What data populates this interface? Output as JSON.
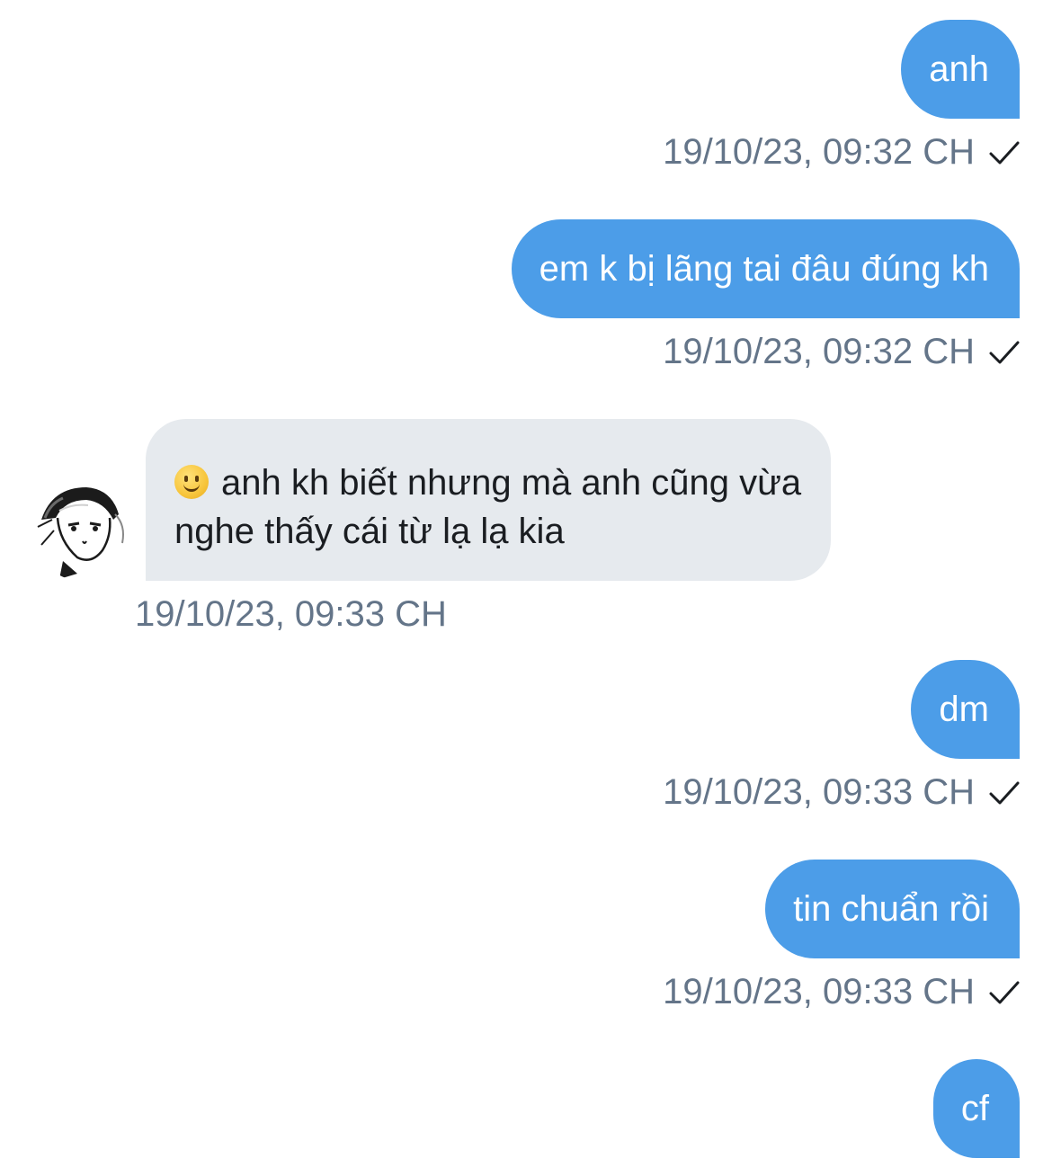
{
  "thread": {
    "messages": [
      {
        "direction": "outgoing",
        "text": "anh",
        "timestamp": "19/10/23, 09:32 CH",
        "status_icon": "check-icon"
      },
      {
        "direction": "outgoing",
        "text": "em k bị lãng tai đâu đúng kh",
        "timestamp": "19/10/23, 09:32 CH",
        "status_icon": "check-icon"
      },
      {
        "direction": "incoming",
        "emoji": "slightly-smiling-face",
        "text": "anh kh biết nhưng mà anh cũng vừa nghe thấy cái từ lạ lạ kia",
        "timestamp": "19/10/23, 09:33 CH",
        "avatar": "manga-style-avatar"
      },
      {
        "direction": "outgoing",
        "text": "dm",
        "timestamp": "19/10/23, 09:33 CH",
        "status_icon": "check-icon"
      },
      {
        "direction": "outgoing",
        "text": "tin chuẩn rồi",
        "timestamp": "19/10/23, 09:33 CH",
        "status_icon": "check-icon"
      },
      {
        "direction": "outgoing",
        "text": "cf"
      }
    ]
  },
  "colors": {
    "outgoing_bubble": "#4c9de8",
    "incoming_bubble": "#e6eaee",
    "timestamp_text": "#647589",
    "background": "#ffffff"
  }
}
